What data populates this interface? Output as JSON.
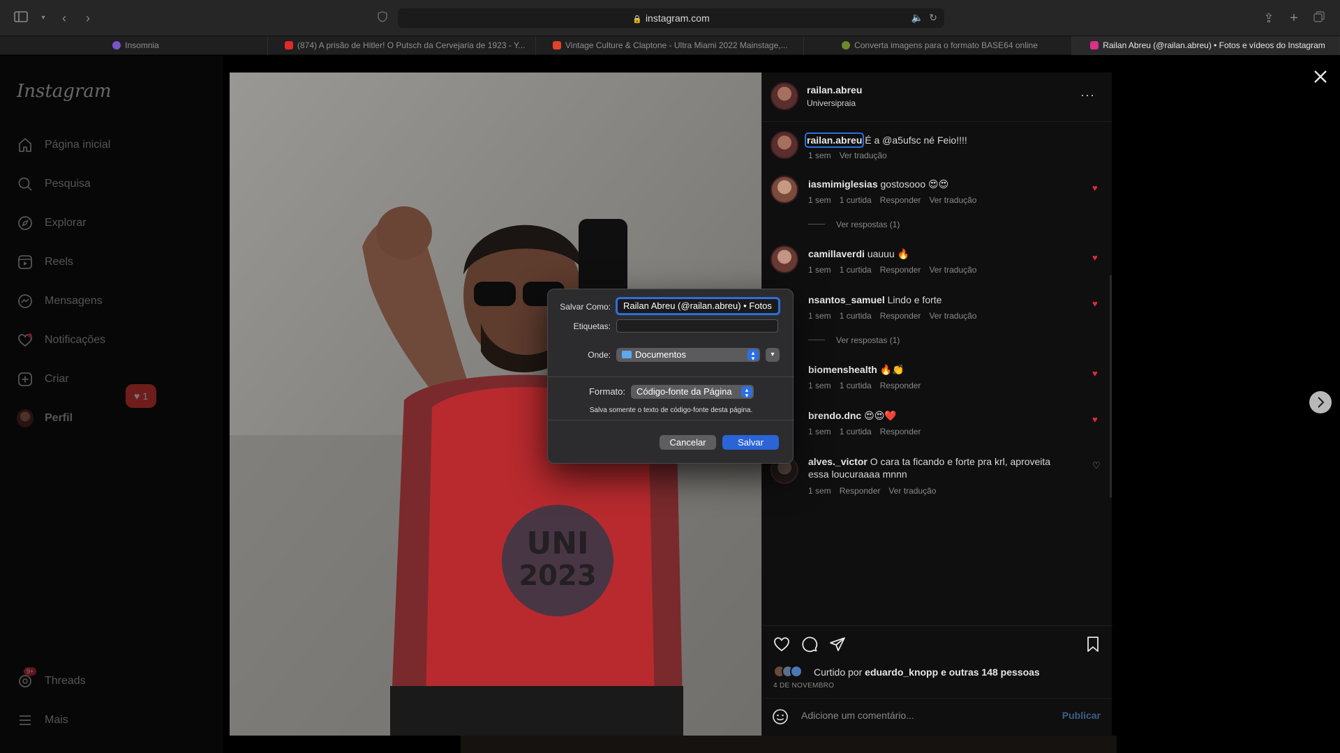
{
  "browser": {
    "url": "instagram.com",
    "tabs": [
      {
        "label": "Insomnia",
        "color": "#7b53c7"
      },
      {
        "label": "(874) A prisão de Hitler! O Putsch da Cervejaria de 1923 - Y...",
        "color": "#e02a2a"
      },
      {
        "label": "Vintage Culture & Claptone - Ultra Miami 2022 Mainstage,...",
        "color": "#e0442a"
      },
      {
        "label": "Converta imagens para o formato BASE64 online",
        "color": "#6b8b2a"
      },
      {
        "label": "Railan Abreu (@railan.abreu) • Fotos e vídeos do Instagram",
        "color": "#d9308a"
      }
    ]
  },
  "sidebar": {
    "logo": "Instagram",
    "items": [
      {
        "label": "Página inicial",
        "icon": "home-icon"
      },
      {
        "label": "Pesquisa",
        "icon": "search-icon"
      },
      {
        "label": "Explorar",
        "icon": "compass-icon"
      },
      {
        "label": "Reels",
        "icon": "reels-icon"
      },
      {
        "label": "Mensagens",
        "icon": "messenger-icon"
      },
      {
        "label": "Notificações",
        "icon": "heart-icon"
      },
      {
        "label": "Criar",
        "icon": "plus-square-icon"
      },
      {
        "label": "Perfil",
        "icon": "avatar"
      }
    ],
    "notif_badge": "1",
    "threads_label": "Threads",
    "threads_badge": "9+",
    "more_label": "Mais"
  },
  "post": {
    "author": "railan.abreu",
    "location": "Universipraia",
    "caption_user": "railan.abreu",
    "caption_text": "É a @a5ufsc né Feio!!!!",
    "caption_time": "1 sem",
    "caption_translate": "Ver tradução",
    "comments": [
      {
        "user": "iasmimiglesias",
        "text": "gostosooo 😍😍",
        "time": "1 sem",
        "likes": "1 curtida",
        "reply": "Responder",
        "translate": "Ver tradução",
        "replies": "Ver respostas (1)",
        "liked": true
      },
      {
        "user": "camillaverdi",
        "text": "uauuu 🔥",
        "time": "1 sem",
        "likes": "1 curtida",
        "reply": "Responder",
        "translate": "Ver tradução",
        "replies": "",
        "liked": true
      },
      {
        "user": "nsantos_samuel",
        "text": "Lindo e forte",
        "time": "1 sem",
        "likes": "1 curtida",
        "reply": "Responder",
        "translate": "Ver tradução",
        "replies": "Ver respostas (1)",
        "liked": true
      },
      {
        "user": "biomenshealth",
        "text": "🔥👏",
        "time": "1 sem",
        "likes": "1 curtida",
        "reply": "Responder",
        "translate": "",
        "replies": "",
        "liked": true
      },
      {
        "user": "brendo.dnc",
        "text": "😍😍❤️",
        "time": "1 sem",
        "likes": "1 curtida",
        "reply": "Responder",
        "translate": "",
        "replies": "",
        "liked": true
      },
      {
        "user": "alves._victor",
        "text": "O cara ta ficando e forte pra krl, aproveita essa loucuraaaa mnnn",
        "time": "1 sem",
        "likes": "",
        "reply": "Responder",
        "translate": "Ver tradução",
        "replies": "",
        "liked": false
      }
    ],
    "liked_by_prefix": "Curtido por",
    "liked_by_user": "eduardo_knopp",
    "liked_by_suffix": "e outras 148 pessoas",
    "date": "4 DE NOVEMBRO",
    "comment_placeholder": "Adicione um comentário...",
    "publish_label": "Publicar"
  },
  "dialog": {
    "save_as_label": "Salvar Como:",
    "save_as_value": "Railan Abreu (@railan.abreu) • Fotos",
    "tags_label": "Etiquetas:",
    "tags_value": "",
    "where_label": "Onde:",
    "where_value": "Documentos",
    "format_label": "Formato:",
    "format_value": "Código-fonte da Página",
    "format_note": "Salva somente o texto de código-fonte desta página.",
    "cancel_label": "Cancelar",
    "save_label": "Salvar",
    "accent": "#2a64d6"
  }
}
